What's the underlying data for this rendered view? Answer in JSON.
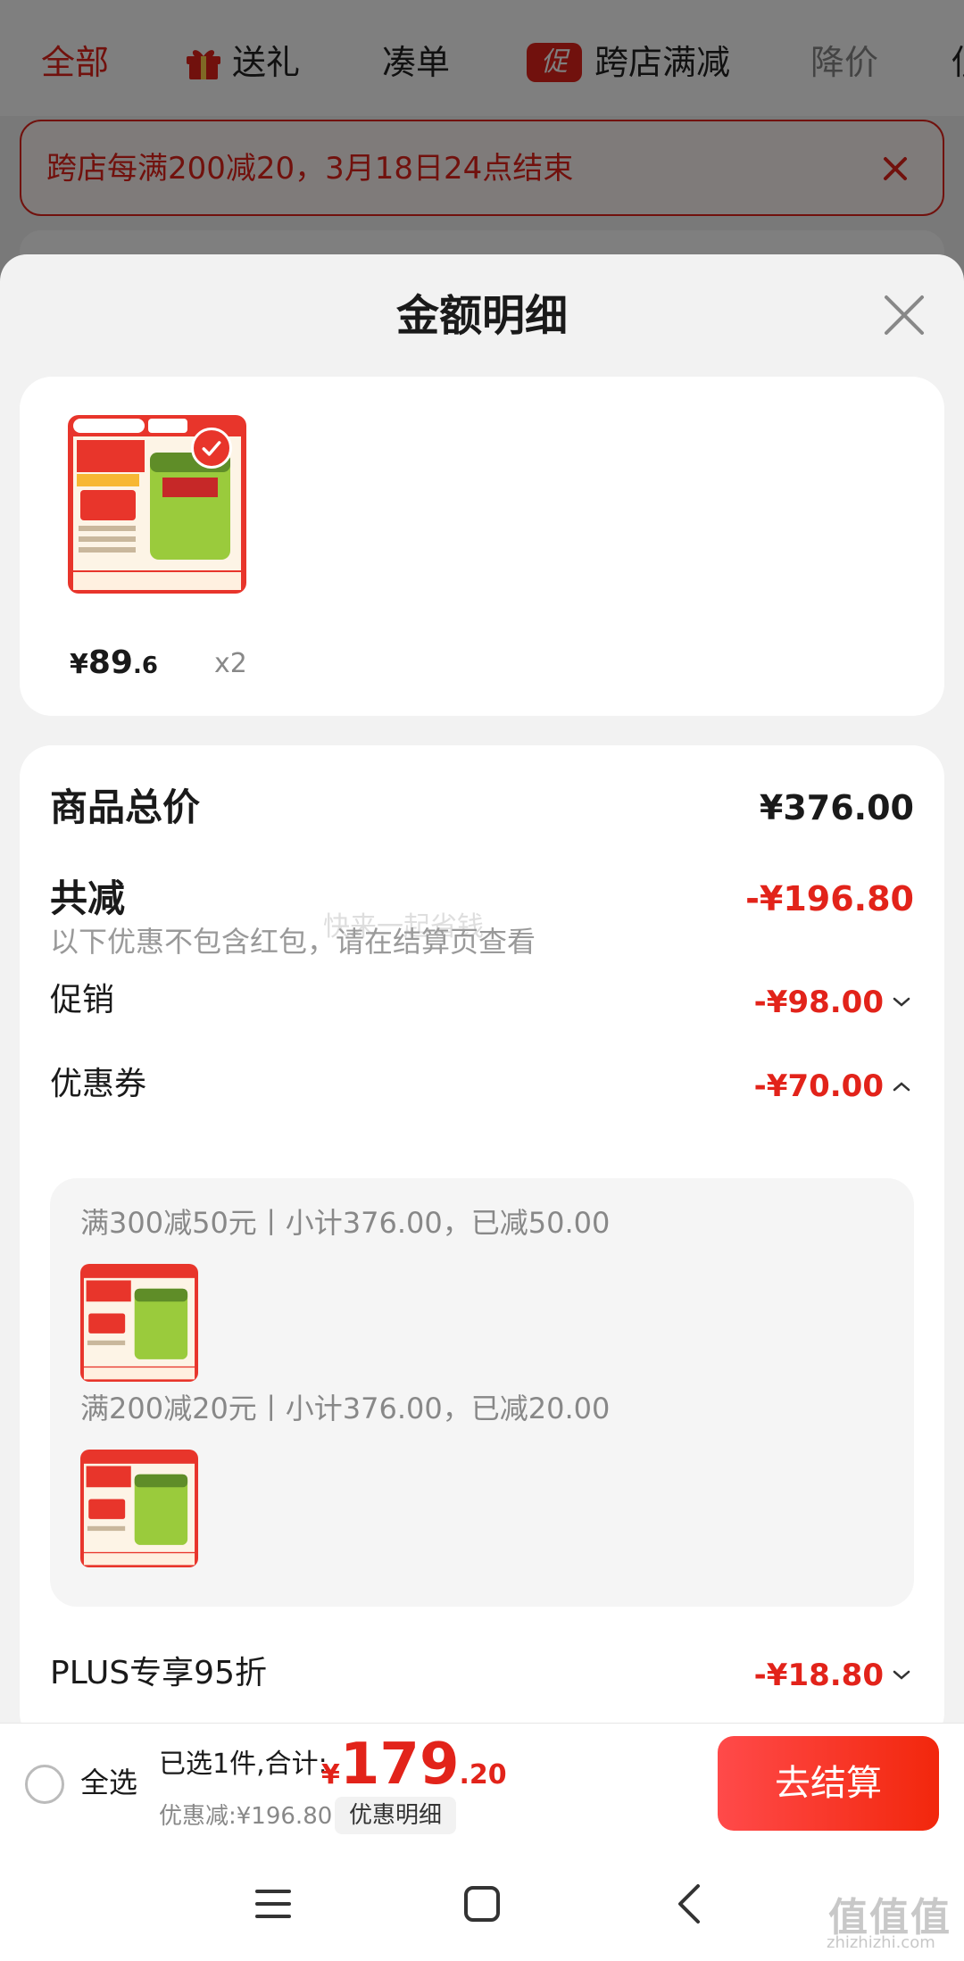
{
  "tabs": [
    {
      "label": "全部",
      "state": "active"
    },
    {
      "label": "送礼",
      "icon": "gift-icon"
    },
    {
      "label": "凑单"
    },
    {
      "label": "跨店满减",
      "badge": "促"
    },
    {
      "label": "降价",
      "state": "muted"
    },
    {
      "label": "低"
    }
  ],
  "banner": {
    "text": "跨店每满200减20，3月18日24点结束"
  },
  "sheet": {
    "title": "金额明细",
    "product": {
      "price_yen": "¥",
      "price_int": "89",
      "price_dec": ".6",
      "qty": "x2"
    },
    "summary": {
      "total_label": "商品总价",
      "total_value": "¥376.00",
      "reduce_label": "共减",
      "reduce_value": "-¥196.80",
      "note": "以下优惠不包含红包，请在结算页查看",
      "watermark": "快来一起省钱"
    },
    "rows": [
      {
        "label": "促销",
        "value": "-¥98.00",
        "chevron": "chevron-down-icon"
      },
      {
        "label": "优惠券",
        "value": "-¥70.00",
        "chevron": "chevron-up-icon"
      },
      {
        "label": "PLUS专享95折",
        "value": "-¥18.80",
        "chevron": "chevron-down-icon"
      }
    ],
    "coupons": [
      {
        "text": "满300减50元丨小计376.00，已减50.00"
      },
      {
        "text": "满200减20元丨小计376.00，已减20.00"
      }
    ]
  },
  "footer": {
    "select_all": "全选",
    "selected": "已选1件,合计:",
    "total_yen": "¥",
    "total_int": "179",
    "total_dec": ".20",
    "discount": "优惠减:¥196.80",
    "detail_button": "优惠明细",
    "checkout": "去结算"
  },
  "watermark": {
    "mark": "值值值",
    "url": "zhizhizhi.com"
  },
  "colors": {
    "accent": "#e2231a",
    "checkout": "#f2270c",
    "product": "#9acb3c"
  }
}
